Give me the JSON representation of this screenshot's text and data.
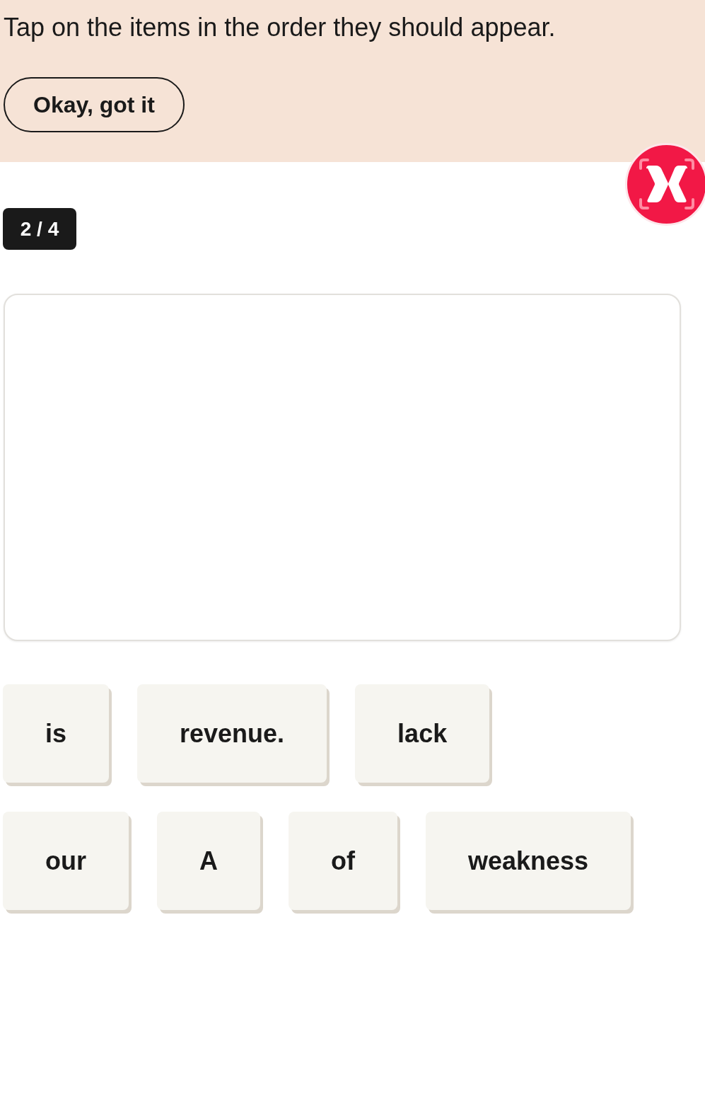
{
  "instruction_banner": {
    "text": "Tap on the items in the order they should appear.",
    "button": "Okay, got it"
  },
  "progress": {
    "counter": "2 / 4"
  },
  "tile_rows": [
    {
      "tiles": [
        "is",
        "revenue.",
        "lack"
      ]
    },
    {
      "tiles": [
        "our",
        "A",
        "of",
        "weakness"
      ]
    }
  ]
}
